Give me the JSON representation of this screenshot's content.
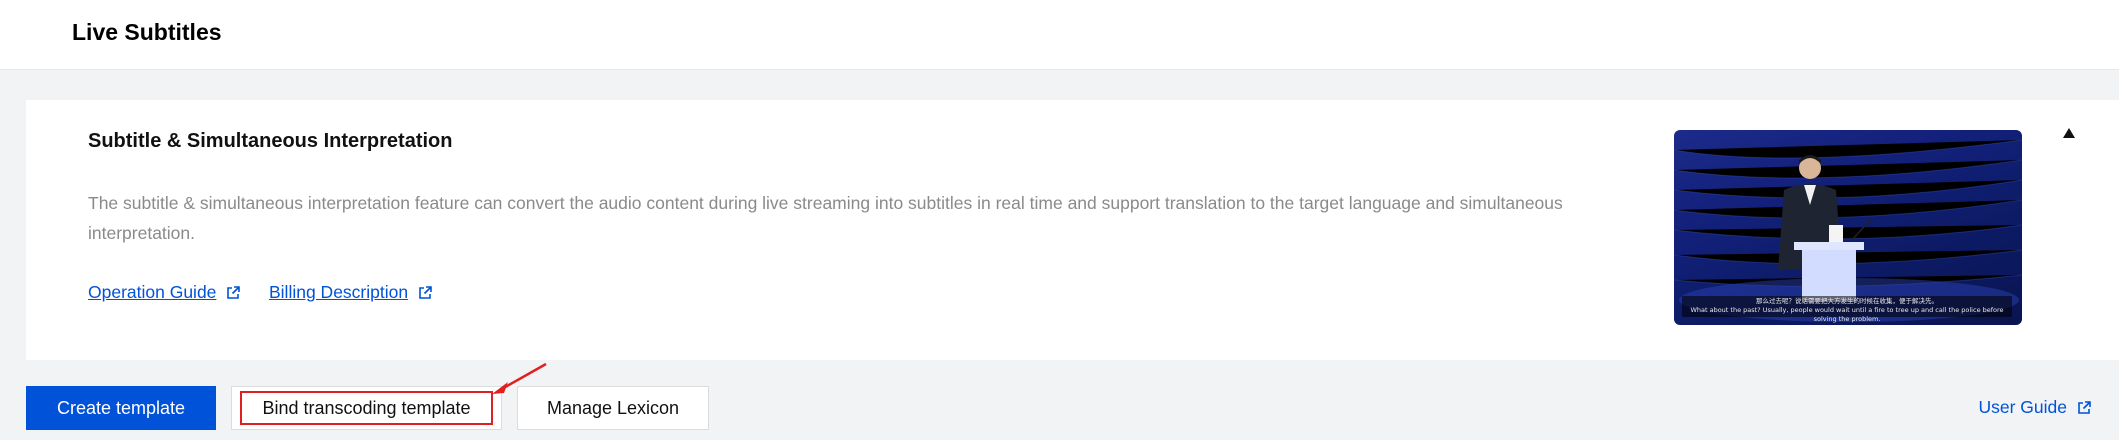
{
  "header": {
    "title": "Live Subtitles"
  },
  "card": {
    "title": "Subtitle & Simultaneous Interpretation",
    "description": "The subtitle & simultaneous interpretation feature can convert the audio content during live streaming into subtitles in real time and support translation to the target language and simultaneous interpretation.",
    "links": {
      "operation_guide": "Operation Guide",
      "billing_description": "Billing Description"
    },
    "preview": {
      "subtitle_line1": "那么过去呢？说话需要把大方发生的时候在收集，便于解决先。",
      "subtitle_line2": "What about the past? Usually, people would wait until a fire to tree up and call the police before solving the problem."
    }
  },
  "actions": {
    "create_template": "Create template",
    "bind_transcoding_template": "Bind transcoding template",
    "manage_lexicon": "Manage Lexicon",
    "user_guide": "User Guide"
  },
  "colors": {
    "primary": "#0052d9",
    "highlight": "#e0201f",
    "background": "#f2f3f5"
  },
  "icons": [
    "external-link-icon",
    "triangle-up-icon",
    "red-arrow-annotation"
  ]
}
